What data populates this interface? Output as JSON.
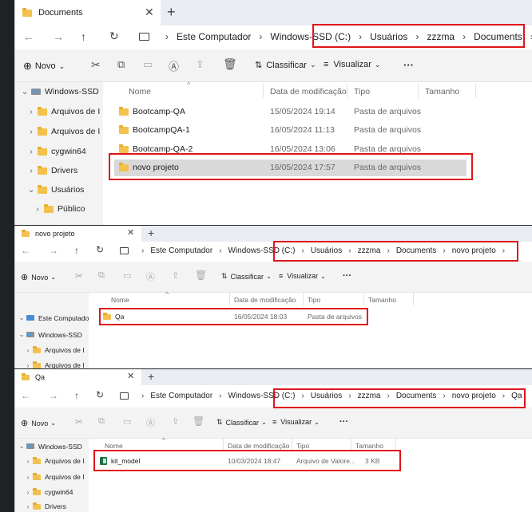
{
  "windows": [
    {
      "tab_title": "Documents",
      "path": [
        "Este Computador",
        "Windows-SSD (C:)",
        "Usuários",
        "zzzma",
        "Documents"
      ],
      "toolbar": {
        "new": "Novo",
        "sort": "Classificar",
        "view": "Visualizar",
        "more": "···"
      },
      "columns": {
        "name": "Nome",
        "date": "Data de modificação",
        "type": "Tipo",
        "size": "Tamanho"
      },
      "sidebar": [
        {
          "label": "Windows-SSD",
          "chevron": "⌄",
          "icon": "drive-icon"
        },
        {
          "label": "Arquivos de I",
          "chevron": "›",
          "icon": "folder-icon"
        },
        {
          "label": "Arquivos de I",
          "chevron": "›",
          "icon": "folder-icon"
        },
        {
          "label": "cygwin64",
          "chevron": "›",
          "icon": "folder-icon"
        },
        {
          "label": "Drivers",
          "chevron": "›",
          "icon": "folder-icon"
        },
        {
          "label": "Usuários",
          "chevron": "⌄",
          "icon": "folder-icon"
        },
        {
          "label": "Público",
          "chevron": "›",
          "icon": "folder-icon"
        }
      ],
      "files": [
        {
          "name": "Bootcamp-QA",
          "date": "15/05/2024 19:14",
          "type": "Pasta de arquivos",
          "size": ""
        },
        {
          "name": "BootcampQA-1",
          "date": "16/05/2024 11:13",
          "type": "Pasta de arquivos",
          "size": ""
        },
        {
          "name": "Bootcamp-QA-2",
          "date": "16/05/2024 13:06",
          "type": "Pasta de arquivos",
          "size": ""
        },
        {
          "name": "novo projeto",
          "date": "16/05/2024 17:57",
          "type": "Pasta de arquivos",
          "size": ""
        }
      ]
    },
    {
      "tab_title": "novo projeto",
      "path": [
        "Este Computador",
        "Windows-SSD (C:)",
        "Usuários",
        "zzzma",
        "Documents",
        "novo projeto"
      ],
      "toolbar": {
        "new": "Novo",
        "sort": "Classificar",
        "view": "Visualizar",
        "more": "···"
      },
      "columns": {
        "name": "Nome",
        "date": "Data de modificação",
        "type": "Tipo",
        "size": "Tamanho"
      },
      "sidebar": [
        {
          "label": "Este Computado",
          "chevron": "⌄",
          "icon": "pc-icon"
        },
        {
          "label": "Windows-SSD",
          "chevron": "⌄",
          "icon": "drive-icon"
        },
        {
          "label": "Arquivos de I",
          "chevron": "›",
          "icon": "folder-icon"
        },
        {
          "label": "Arquivos de I",
          "chevron": "›",
          "icon": "folder-icon"
        }
      ],
      "files": [
        {
          "name": "Qa",
          "date": "16/05/2024 18:03",
          "type": "Pasta de arquivos",
          "size": ""
        }
      ]
    },
    {
      "tab_title": "Qa",
      "path": [
        "Este Computador",
        "Windows-SSD (C:)",
        "Usuários",
        "zzzma",
        "Documents",
        "novo projeto",
        "Qa"
      ],
      "toolbar": {
        "new": "Novo",
        "sort": "Classificar",
        "view": "Visualizar",
        "more": "···"
      },
      "columns": {
        "name": "Nome",
        "date": "Data de modificação",
        "type": "Tipo",
        "size": "Tamanho"
      },
      "sidebar": [
        {
          "label": "Windows-SSD",
          "chevron": "⌄",
          "icon": "drive-icon"
        },
        {
          "label": "Arquivos de I",
          "chevron": "›",
          "icon": "folder-icon"
        },
        {
          "label": "Arquivos de I",
          "chevron": "›",
          "icon": "folder-icon"
        },
        {
          "label": "cygwin64",
          "chevron": "›",
          "icon": "folder-icon"
        },
        {
          "label": "Drivers",
          "chevron": "›",
          "icon": "folder-icon"
        }
      ],
      "files": [
        {
          "name": "kit_model",
          "date": "10/03/2024 18:47",
          "type": "Arquivo de Valore...",
          "size": "3 KB",
          "icon": "excel-file-icon"
        }
      ]
    }
  ],
  "colors": {
    "highlight_border": "#e0151b",
    "selected_row": "#d9d9d9",
    "folder": "#f2c14e"
  }
}
